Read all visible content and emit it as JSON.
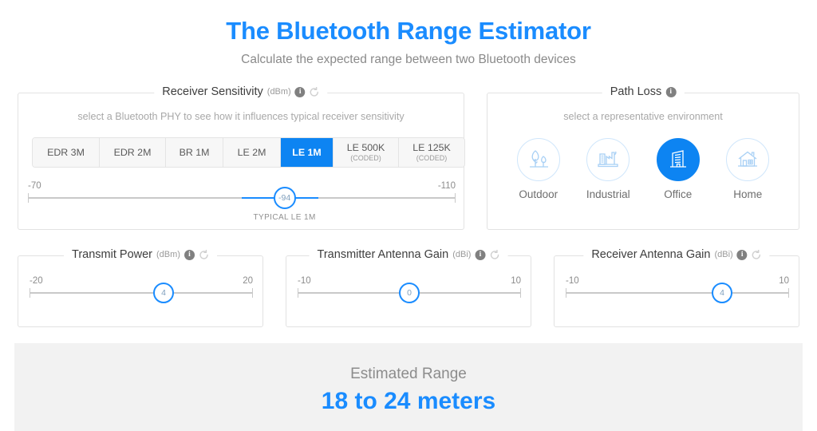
{
  "header": {
    "title": "The Bluetooth Range Estimator",
    "subtitle": "Calculate the expected range between two Bluetooth devices",
    "title_color": "#1a8cff"
  },
  "accent_color": "#0d84f2",
  "icons": {
    "info": "info-icon",
    "reset": "reset-icon"
  },
  "receiver_sensitivity": {
    "legend": "Receiver Sensitivity",
    "unit": "(dBm)",
    "hint": "select a Bluetooth PHY to see how it influences typical receiver sensitivity",
    "phy_options": [
      {
        "label": "EDR 3M",
        "sub": "",
        "selected": false
      },
      {
        "label": "EDR 2M",
        "sub": "",
        "selected": false
      },
      {
        "label": "BR 1M",
        "sub": "",
        "selected": false
      },
      {
        "label": "LE 2M",
        "sub": "",
        "selected": false
      },
      {
        "label": "LE 1M",
        "sub": "",
        "selected": true
      },
      {
        "label": "LE 500K",
        "sub": "(CODED)",
        "selected": false
      },
      {
        "label": "LE 125K",
        "sub": "(CODED)",
        "selected": false
      }
    ],
    "slider": {
      "min_label": "-70",
      "max_label": "-110",
      "value": "-94",
      "caption": "TYPICAL LE 1M"
    }
  },
  "path_loss": {
    "legend": "Path Loss",
    "hint": "select a representative environment",
    "environments": [
      {
        "label": "Outdoor",
        "icon": "trees-icon",
        "selected": false
      },
      {
        "label": "Industrial",
        "icon": "factory-icon",
        "selected": false
      },
      {
        "label": "Office",
        "icon": "office-building-icon",
        "selected": true
      },
      {
        "label": "Home",
        "icon": "house-icon",
        "selected": false
      }
    ]
  },
  "transmit_power": {
    "legend": "Transmit Power",
    "unit": "(dBm)",
    "slider": {
      "min_label": "-20",
      "max_label": "20",
      "value": "4"
    }
  },
  "transmitter_antenna_gain": {
    "legend": "Transmitter Antenna Gain",
    "unit": "(dBi)",
    "slider": {
      "min_label": "-10",
      "max_label": "10",
      "value": "0"
    }
  },
  "receiver_antenna_gain": {
    "legend": "Receiver Antenna Gain",
    "unit": "(dBi)",
    "slider": {
      "min_label": "-10",
      "max_label": "10",
      "value": "4"
    }
  },
  "result": {
    "label": "Estimated Range",
    "value": "18 to 24 meters"
  }
}
